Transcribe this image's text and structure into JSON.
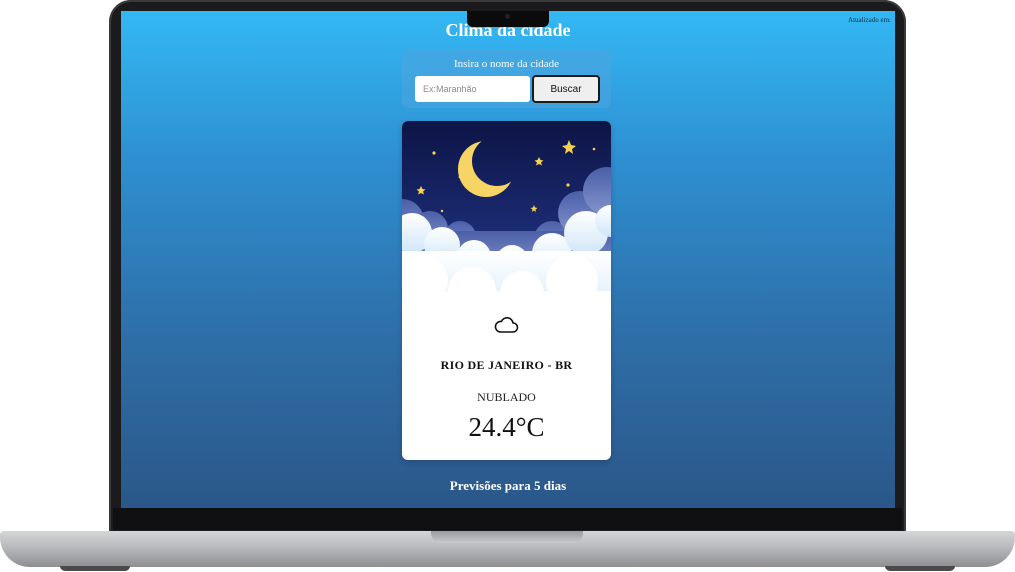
{
  "header": {
    "updated_label": "Atualizado em:",
    "title": "Clima da cidade"
  },
  "search": {
    "label": "Insira o nome da cidade",
    "placeholder": "Ex:Maranhão",
    "value": "",
    "button_label": "Buscar"
  },
  "weather": {
    "city": "RIO DE JANEIRO - BR",
    "condition": "NUBLADO",
    "temperature": "24.4°C",
    "icon": "cloud-icon",
    "illustration": "moon-night-clouds"
  },
  "forecast": {
    "title": "Previsões para 5 dias"
  },
  "colors": {
    "background_top": "#33b8f4",
    "background_bottom": "#2b5789",
    "night_sky": "#111b4e",
    "moon": "#f6d565"
  }
}
